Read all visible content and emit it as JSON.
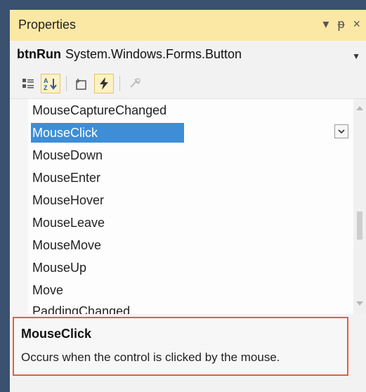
{
  "panel": {
    "title": "Properties",
    "buttons": [
      "▾",
      "ᵽ",
      "×"
    ]
  },
  "object": {
    "name": "btnRun",
    "type": "System.Windows.Forms.Button"
  },
  "toolbar": {
    "icons": [
      "categorized-icon",
      "alphabetical-icon",
      "properties-icon",
      "events-icon",
      "property-pages-icon"
    ],
    "active": [
      "alphabetical-icon",
      "events-icon"
    ]
  },
  "events": [
    {
      "label": "MouseCaptureChanged"
    },
    {
      "label": "MouseClick",
      "selected": true
    },
    {
      "label": "MouseDown"
    },
    {
      "label": "MouseEnter"
    },
    {
      "label": "MouseHover"
    },
    {
      "label": "MouseLeave"
    },
    {
      "label": "MouseMove"
    },
    {
      "label": "MouseUp"
    },
    {
      "label": "Move"
    },
    {
      "label": "PaddingChanged"
    }
  ],
  "description": {
    "title": "MouseClick",
    "text": "Occurs when the control is clicked by the mouse."
  },
  "colors": {
    "title_bar": "#fce8a5",
    "selection": "#3d8ed6",
    "highlight_border": "#e0623a"
  }
}
